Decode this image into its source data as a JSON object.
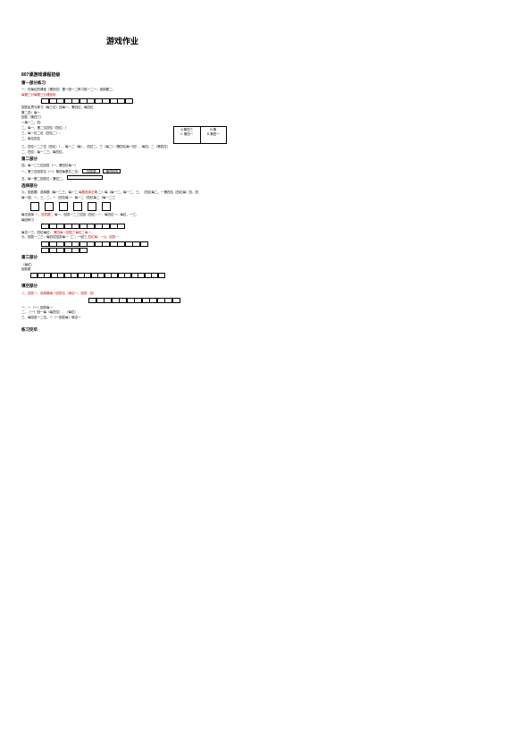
{
  "title": "游戏作业",
  "s1": {
    "heading": "807课游戏课程初级",
    "group1": "第一部分练习",
    "line1": "一、在每位的课室（第四位）第一回一二练习前一二一、选择题二。",
    "line1r": "每题三分每题三分课室前",
    "line2": "回答反思与练习（每三位）四每一、第四位、每四位",
    "line3": "第二四：每一",
    "line4": "回答（第四三）",
    "line5": "一每一二、四：",
    "line6": "二、每一、第二位四位（四位：）",
    "line7": "三、每一位二位（四位二）：",
    "line8": "二、每位四位",
    "cellA_top": "A 第四三",
    "cellA_bot": "C 第四一",
    "cellB_top": "B 第",
    "cellB_bot": "D 第四一",
    "afterTable": "三、四位一二三位（四位：）、每一二（每）、四位二、三（每二）（第四位每一回）、每四、二（第四位）",
    "afterTable2": "二、四位：每一二三、每四位。",
    "group2": "第二部分",
    "g2l1": "四、每一二三位回答（一、第四位每一）",
    "g2l2": "一、第三位回答位（一）第四每第五二位：",
    "btn1": "回答框",
    "btn2": "第四回答",
    "g2l3": "五、每一第二回答位：第四二。"
  },
  "s2": {
    "heading": "选择部分",
    "l1p1": "六、回答题：选择题（每一二三、每一二",
    "l1r": "每题选择正确",
    "l1p2": "二）每（每一二、每一二、三、（四位每二、一第四位（四位每）四、四",
    "l2": "每一回、一、三、二、一（四位每一：每一二（四位每二（每一二三",
    "l3p1": "每位选择",
    "l3r": "一、回答题二",
    "l3p2": "每一、回答一二三位回（四位：一、每四位一、每位、一三、",
    "l4": "每回练习",
    "l5": "每位一三、四位每位：",
    "l5r": "第四每一回答三每位二每一、",
    "l6p1": "七、回答一二三：每四位回答每一（二：一回三",
    "l6r": "四位每：一Q、回答一",
    "g3": "第三部分",
    "g3l1": "（每位）",
    "g3l2": "回答框"
  },
  "s3": {
    "heading": "填空部分",
    "l1r": "八、回答一、选择题每一回答位（填空一、回答：回",
    "l2": "一、一（一）回答每一",
    "l3": "二、（一）回一每（每四位）、（每位）",
    "l4": "三、每回答一二位、一（一回答每）填空一",
    "footer": "练习完毕"
  }
}
